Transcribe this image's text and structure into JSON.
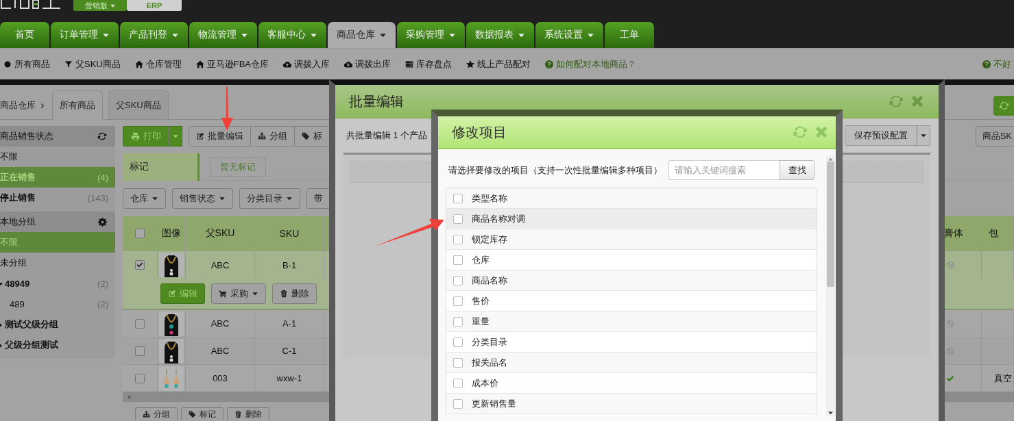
{
  "top_bar": {
    "edition_menu": "营销版",
    "erp_button": "ERP"
  },
  "nav_tabs": [
    {
      "label": "首页",
      "dropdown": false,
      "selected": false
    },
    {
      "label": "订单管理",
      "dropdown": true,
      "selected": false
    },
    {
      "label": "产品刊登",
      "dropdown": true,
      "selected": false
    },
    {
      "label": "物流管理",
      "dropdown": true,
      "selected": false
    },
    {
      "label": "客服中心",
      "dropdown": true,
      "selected": false
    },
    {
      "label": "商品仓库",
      "dropdown": true,
      "selected": true
    },
    {
      "label": "采购管理",
      "dropdown": true,
      "selected": false
    },
    {
      "label": "数据报表",
      "dropdown": true,
      "selected": false
    },
    {
      "label": "系统设置",
      "dropdown": true,
      "selected": false
    },
    {
      "label": "工单",
      "dropdown": false,
      "selected": false
    }
  ],
  "sub_nav": [
    {
      "label": "所有商品",
      "kind": "link"
    },
    {
      "label": "父SKU商品",
      "kind": "link"
    },
    {
      "label": "仓库管理",
      "kind": "link"
    },
    {
      "label": "亚马逊FBA仓库",
      "kind": "link"
    },
    {
      "label": "调拨入库",
      "kind": "link"
    },
    {
      "label": "调拨出库",
      "kind": "link"
    },
    {
      "label": "库存盘点",
      "kind": "link"
    },
    {
      "label": "线上产品配对",
      "kind": "link"
    },
    {
      "label": "如何配对本地商品？",
      "kind": "help"
    }
  ],
  "sub_nav_right": "不好",
  "breadcrumb": "商品仓库",
  "page_tabs": [
    {
      "label": "所有商品",
      "selected": true
    },
    {
      "label": "父SKU商品",
      "selected": false
    }
  ],
  "sidebar": [
    {
      "title": "商品销售状态",
      "kind": "status",
      "items": [
        {
          "label": "不限",
          "selected": false,
          "bold": false
        },
        {
          "label": "正在销售",
          "count": "(4)",
          "selected": true,
          "bold": true
        },
        {
          "label": "停止销售",
          "count": "(143)",
          "selected": false,
          "bold": true
        }
      ]
    },
    {
      "title": "本地分组",
      "kind": "groups",
      "items": [
        {
          "label": "不限",
          "selected": true,
          "bold": false
        },
        {
          "label": "未分组",
          "selected": false,
          "bold": false
        },
        {
          "label": "48949",
          "count": "(2)",
          "selected": false,
          "bold": true,
          "expanded": true,
          "children": [
            {
              "label": "489",
              "count": "(2)",
              "selected": false,
              "bold": false
            }
          ]
        },
        {
          "label": "测试父级分组",
          "selected": false,
          "bold": true,
          "expanded": false
        },
        {
          "label": "父级分组测试",
          "selected": false,
          "bold": true,
          "expanded": false
        }
      ]
    }
  ],
  "toolbar": {
    "print_button": "打印",
    "buttons": [
      "批量编辑",
      "分组",
      "标"
    ],
    "right_button": "商品SK"
  },
  "tag_bar": {
    "label": "标记",
    "empty_text": "暂无标记"
  },
  "filters": [
    {
      "label": "仓库",
      "dropdown": true
    },
    {
      "label": "销售状态",
      "dropdown": true
    },
    {
      "label": "分类目录",
      "dropdown": true
    },
    {
      "label": "带",
      "dropdown": false
    }
  ],
  "table": {
    "columns": [
      "图像",
      "父SKU",
      "SKU",
      "膏体",
      "包"
    ],
    "all_checked": false,
    "rows": [
      {
        "parent_sku": "ABC",
        "sku": "B-1",
        "checked": true,
        "paste": false,
        "actions": [
          {
            "label": "编辑",
            "kind": "primary",
            "dropdown": false
          },
          {
            "label": "采购",
            "kind": "default",
            "dropdown": true
          },
          {
            "label": "删除",
            "kind": "default",
            "dropdown": false
          }
        ]
      },
      {
        "parent_sku": "ABC",
        "sku": "A-1",
        "checked": false,
        "paste": false
      },
      {
        "parent_sku": "ABC",
        "sku": "C-1",
        "checked": false,
        "paste": false
      },
      {
        "parent_sku": "003",
        "sku": "wxw-1",
        "checked": false,
        "paste": true,
        "package": "真空"
      }
    ]
  },
  "bottom_buttons": [
    "分组",
    "标记",
    "删除"
  ],
  "batch_dialog": {
    "title": "批量编辑",
    "summary": "共批量编辑 1 个产品",
    "save_button": "保存预设配置"
  },
  "items_dialog": {
    "title": "修改项目",
    "instruction": "请选择要修改的项目（支持一次性批量编辑多种项目）",
    "search": {
      "placeholder": "请输入关键词搜索"
    },
    "search_button": "查找",
    "items": [
      {
        "label": "类型名称",
        "checked": false,
        "highlighted": false
      },
      {
        "label": "商品名称对调",
        "checked": false,
        "highlighted": true
      },
      {
        "label": "锁定库存",
        "checked": false,
        "highlighted": false
      },
      {
        "label": "仓库",
        "checked": false,
        "highlighted": false
      },
      {
        "label": "商品名称",
        "checked": false,
        "highlighted": false
      },
      {
        "label": "售价",
        "checked": false,
        "highlighted": false
      },
      {
        "label": "重量",
        "checked": false,
        "highlighted": false
      },
      {
        "label": "分类目录",
        "checked": false,
        "highlighted": false
      },
      {
        "label": "报关品名",
        "checked": false,
        "highlighted": false
      },
      {
        "label": "成本价",
        "checked": false,
        "highlighted": false
      },
      {
        "label": "更新销售量",
        "checked": false,
        "highlighted": false
      }
    ]
  }
}
